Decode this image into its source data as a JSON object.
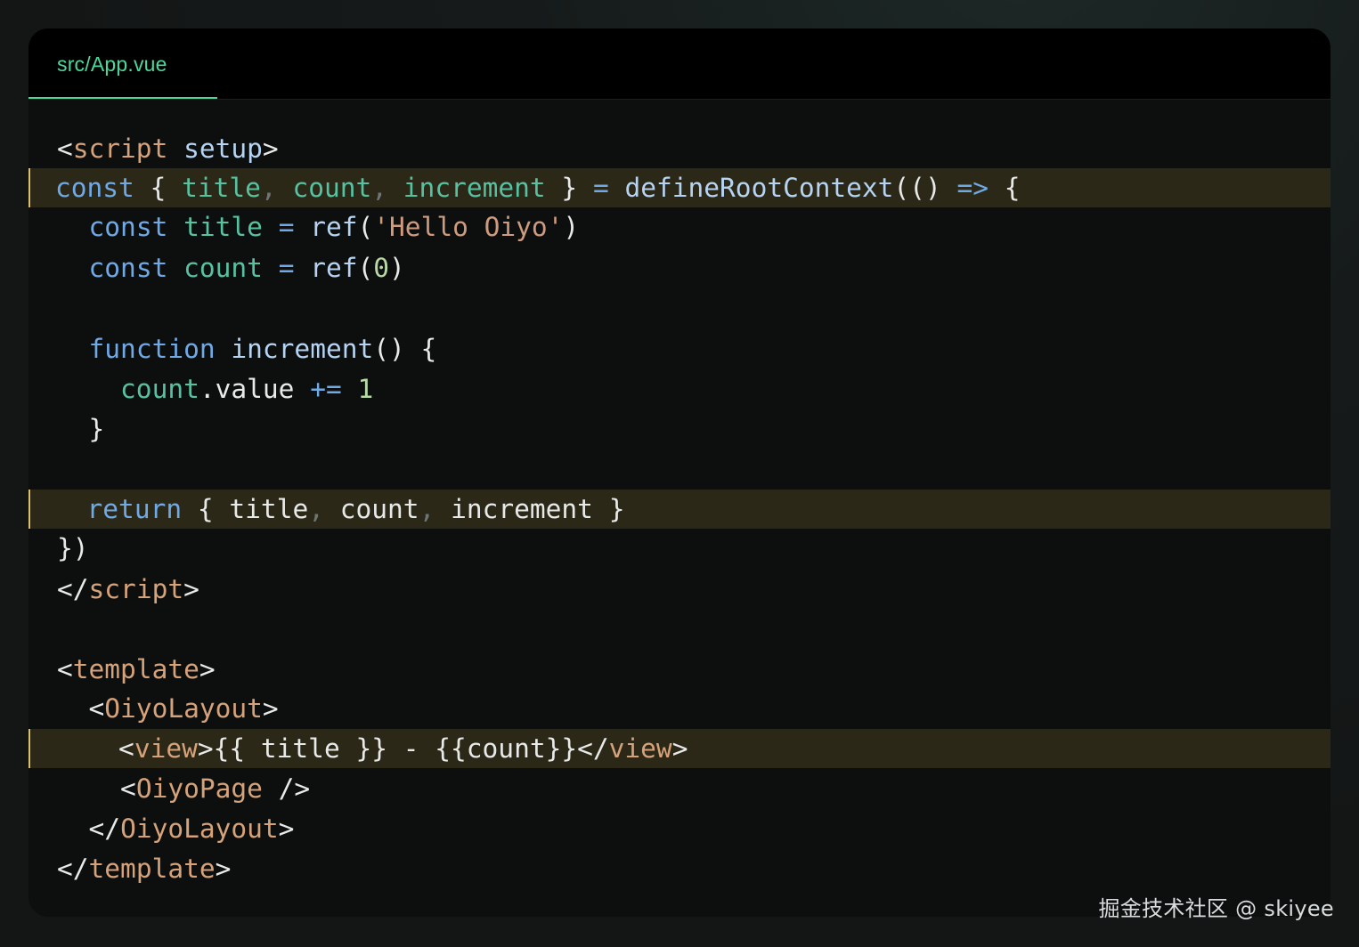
{
  "tab": {
    "label": "src/App.vue"
  },
  "code": {
    "lines": [
      {
        "highlight": false,
        "tokens": [
          {
            "t": "<",
            "c": "pn"
          },
          {
            "t": "script",
            "c": "tg"
          },
          {
            "t": " ",
            "c": "tx"
          },
          {
            "t": "setup",
            "c": "fn"
          },
          {
            "t": ">",
            "c": "pn"
          }
        ]
      },
      {
        "highlight": true,
        "tokens": [
          {
            "t": "const",
            "c": "kw"
          },
          {
            "t": " ",
            "c": "tx"
          },
          {
            "t": "{",
            "c": "pn"
          },
          {
            "t": " ",
            "c": "tx"
          },
          {
            "t": "title",
            "c": "id"
          },
          {
            "t": ",",
            "c": "cm"
          },
          {
            "t": " ",
            "c": "tx"
          },
          {
            "t": "count",
            "c": "id"
          },
          {
            "t": ",",
            "c": "cm"
          },
          {
            "t": " ",
            "c": "tx"
          },
          {
            "t": "increment",
            "c": "id"
          },
          {
            "t": " ",
            "c": "tx"
          },
          {
            "t": "}",
            "c": "pn"
          },
          {
            "t": " ",
            "c": "tx"
          },
          {
            "t": "=",
            "c": "op"
          },
          {
            "t": " ",
            "c": "tx"
          },
          {
            "t": "defineRootContext",
            "c": "fn"
          },
          {
            "t": "(()",
            "c": "pn"
          },
          {
            "t": " ",
            "c": "tx"
          },
          {
            "t": "=>",
            "c": "op"
          },
          {
            "t": " ",
            "c": "tx"
          },
          {
            "t": "{",
            "c": "pn"
          }
        ]
      },
      {
        "highlight": false,
        "tokens": [
          {
            "t": "  ",
            "c": "tx"
          },
          {
            "t": "const",
            "c": "kw"
          },
          {
            "t": " ",
            "c": "tx"
          },
          {
            "t": "title",
            "c": "id"
          },
          {
            "t": " ",
            "c": "tx"
          },
          {
            "t": "=",
            "c": "op"
          },
          {
            "t": " ",
            "c": "tx"
          },
          {
            "t": "ref",
            "c": "fn"
          },
          {
            "t": "(",
            "c": "pn"
          },
          {
            "t": "'Hello Oiyo'",
            "c": "st"
          },
          {
            "t": ")",
            "c": "pn"
          }
        ]
      },
      {
        "highlight": false,
        "tokens": [
          {
            "t": "  ",
            "c": "tx"
          },
          {
            "t": "const",
            "c": "kw"
          },
          {
            "t": " ",
            "c": "tx"
          },
          {
            "t": "count",
            "c": "id"
          },
          {
            "t": " ",
            "c": "tx"
          },
          {
            "t": "=",
            "c": "op"
          },
          {
            "t": " ",
            "c": "tx"
          },
          {
            "t": "ref",
            "c": "fn"
          },
          {
            "t": "(",
            "c": "pn"
          },
          {
            "t": "0",
            "c": "nm"
          },
          {
            "t": ")",
            "c": "pn"
          }
        ]
      },
      {
        "highlight": false,
        "tokens": []
      },
      {
        "highlight": false,
        "tokens": [
          {
            "t": "  ",
            "c": "tx"
          },
          {
            "t": "function",
            "c": "kw"
          },
          {
            "t": " ",
            "c": "tx"
          },
          {
            "t": "increment",
            "c": "fn"
          },
          {
            "t": "()",
            "c": "pn"
          },
          {
            "t": " ",
            "c": "tx"
          },
          {
            "t": "{",
            "c": "pn"
          }
        ]
      },
      {
        "highlight": false,
        "tokens": [
          {
            "t": "    ",
            "c": "tx"
          },
          {
            "t": "count",
            "c": "id"
          },
          {
            "t": ".value",
            "c": "pn"
          },
          {
            "t": " ",
            "c": "tx"
          },
          {
            "t": "+=",
            "c": "op"
          },
          {
            "t": " ",
            "c": "tx"
          },
          {
            "t": "1",
            "c": "nm"
          }
        ]
      },
      {
        "highlight": false,
        "tokens": [
          {
            "t": "  ",
            "c": "tx"
          },
          {
            "t": "}",
            "c": "pn"
          }
        ]
      },
      {
        "highlight": false,
        "tokens": []
      },
      {
        "highlight": true,
        "tokens": [
          {
            "t": "  ",
            "c": "tx"
          },
          {
            "t": "return",
            "c": "kw"
          },
          {
            "t": " ",
            "c": "tx"
          },
          {
            "t": "{",
            "c": "pn"
          },
          {
            "t": " ",
            "c": "tx"
          },
          {
            "t": "title",
            "c": "pn"
          },
          {
            "t": ",",
            "c": "cm"
          },
          {
            "t": " ",
            "c": "tx"
          },
          {
            "t": "count",
            "c": "pn"
          },
          {
            "t": ",",
            "c": "cm"
          },
          {
            "t": " ",
            "c": "tx"
          },
          {
            "t": "increment",
            "c": "pn"
          },
          {
            "t": " ",
            "c": "tx"
          },
          {
            "t": "}",
            "c": "pn"
          }
        ]
      },
      {
        "highlight": false,
        "tokens": [
          {
            "t": "})",
            "c": "pn"
          }
        ]
      },
      {
        "highlight": false,
        "tokens": [
          {
            "t": "</",
            "c": "pn"
          },
          {
            "t": "script",
            "c": "tg"
          },
          {
            "t": ">",
            "c": "pn"
          }
        ]
      },
      {
        "highlight": false,
        "tokens": []
      },
      {
        "highlight": false,
        "tokens": [
          {
            "t": "<",
            "c": "pn"
          },
          {
            "t": "template",
            "c": "tg"
          },
          {
            "t": ">",
            "c": "pn"
          }
        ]
      },
      {
        "highlight": false,
        "tokens": [
          {
            "t": "  ",
            "c": "tx"
          },
          {
            "t": "<",
            "c": "pn"
          },
          {
            "t": "OiyoLayout",
            "c": "tg"
          },
          {
            "t": ">",
            "c": "pn"
          }
        ]
      },
      {
        "highlight": true,
        "tokens": [
          {
            "t": "    ",
            "c": "tx"
          },
          {
            "t": "<",
            "c": "pn"
          },
          {
            "t": "view",
            "c": "tg"
          },
          {
            "t": ">{{ title }} - {{count}}</",
            "c": "pn"
          },
          {
            "t": "view",
            "c": "tg"
          },
          {
            "t": ">",
            "c": "pn"
          }
        ]
      },
      {
        "highlight": false,
        "tokens": [
          {
            "t": "    ",
            "c": "tx"
          },
          {
            "t": "<",
            "c": "pn"
          },
          {
            "t": "OiyoPage",
            "c": "tg"
          },
          {
            "t": " />",
            "c": "pn"
          }
        ]
      },
      {
        "highlight": false,
        "tokens": [
          {
            "t": "  ",
            "c": "tx"
          },
          {
            "t": "</",
            "c": "pn"
          },
          {
            "t": "OiyoLayout",
            "c": "tg"
          },
          {
            "t": ">",
            "c": "pn"
          }
        ]
      },
      {
        "highlight": false,
        "tokens": [
          {
            "t": "</",
            "c": "pn"
          },
          {
            "t": "template",
            "c": "tg"
          },
          {
            "t": ">",
            "c": "pn"
          }
        ]
      }
    ]
  },
  "watermark": {
    "text": "掘金技术社区 @ skiyee"
  }
}
